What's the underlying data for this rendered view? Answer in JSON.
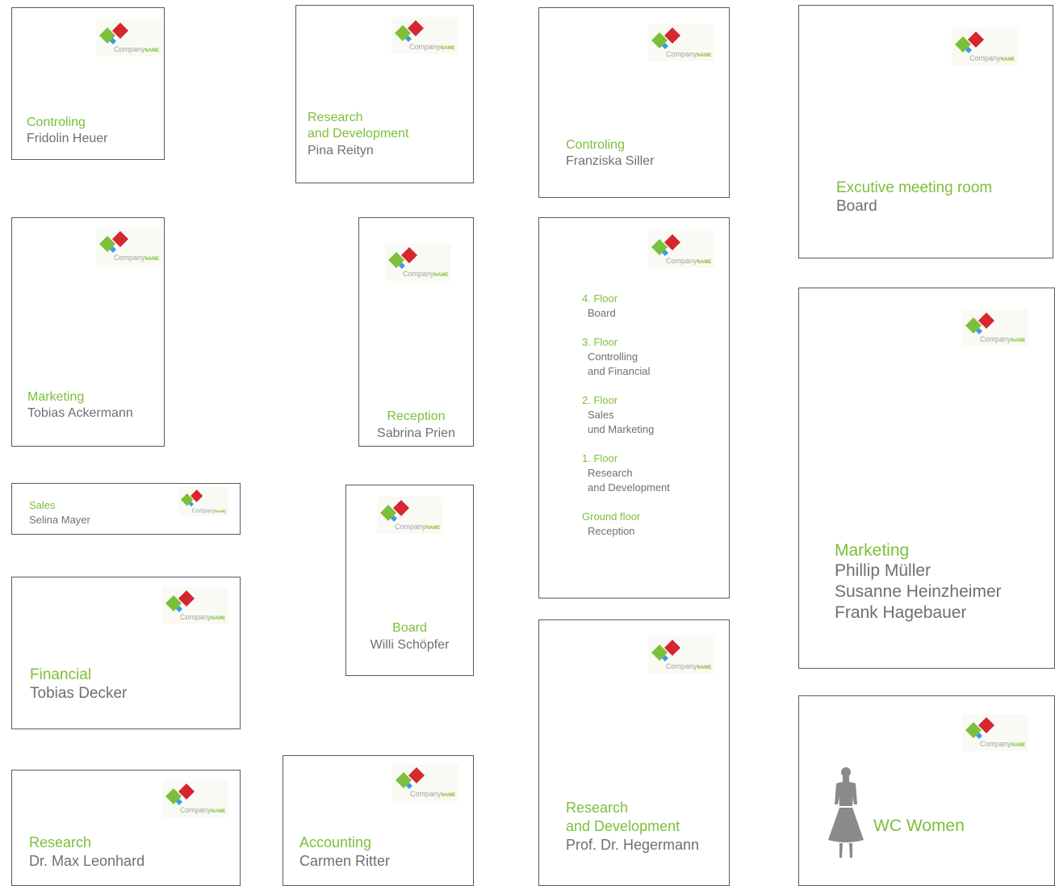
{
  "brand": {
    "logo_text": "Company",
    "logo_accent": "NAME",
    "colors": {
      "green": "#7cbf3a",
      "red": "#d6262f",
      "blue": "#3c9be0",
      "text_gray": "#6f6f6f"
    }
  },
  "signs": {
    "controling_heuer": {
      "dept": "Controling",
      "name": "Fridolin Heuer"
    },
    "rnd_reityn": {
      "dept_line1": "Research",
      "dept_line2": "and Development",
      "name": "Pina Reityn"
    },
    "controling_siller": {
      "dept": "Controling",
      "name": "Franziska Siller"
    },
    "exec_room": {
      "dept": "Excutive meeting room",
      "name": "Board"
    },
    "marketing_ackermann": {
      "dept": "Marketing",
      "name": "Tobias Ackermann"
    },
    "reception": {
      "dept": "Reception",
      "name": "Sabrina Prien"
    },
    "sales": {
      "dept": "Sales",
      "name": "Selina Mayer"
    },
    "board": {
      "dept": "Board",
      "name": "Willi Schöpfer"
    },
    "marketing_group": {
      "dept": "Marketing",
      "names": [
        "Phillip Müller",
        "Susanne Heinzheimer",
        "Frank Hagebauer"
      ]
    },
    "financial": {
      "dept": "Financial",
      "name": "Tobias Decker"
    },
    "research": {
      "dept": "Research",
      "name": "Dr. Max Leonhard"
    },
    "accounting": {
      "dept": "Accounting",
      "name": "Carmen Ritter"
    },
    "rnd_hegermann": {
      "dept_line1": "Research",
      "dept_line2": "and Development",
      "name": "Prof. Dr. Hegermann"
    },
    "wc": {
      "label": "WC Women",
      "icon": "woman-icon"
    }
  },
  "directory": [
    {
      "floor": "4. Floor",
      "depts": [
        "Board"
      ]
    },
    {
      "floor": "3. Floor",
      "depts": [
        "Controlling",
        "and Financial"
      ]
    },
    {
      "floor": "2. Floor",
      "depts": [
        "Sales",
        "und Marketing"
      ]
    },
    {
      "floor": "1. Floor",
      "depts": [
        "Research",
        "and Development"
      ]
    },
    {
      "floor": "Ground floor",
      "depts": [
        "Reception"
      ]
    }
  ]
}
